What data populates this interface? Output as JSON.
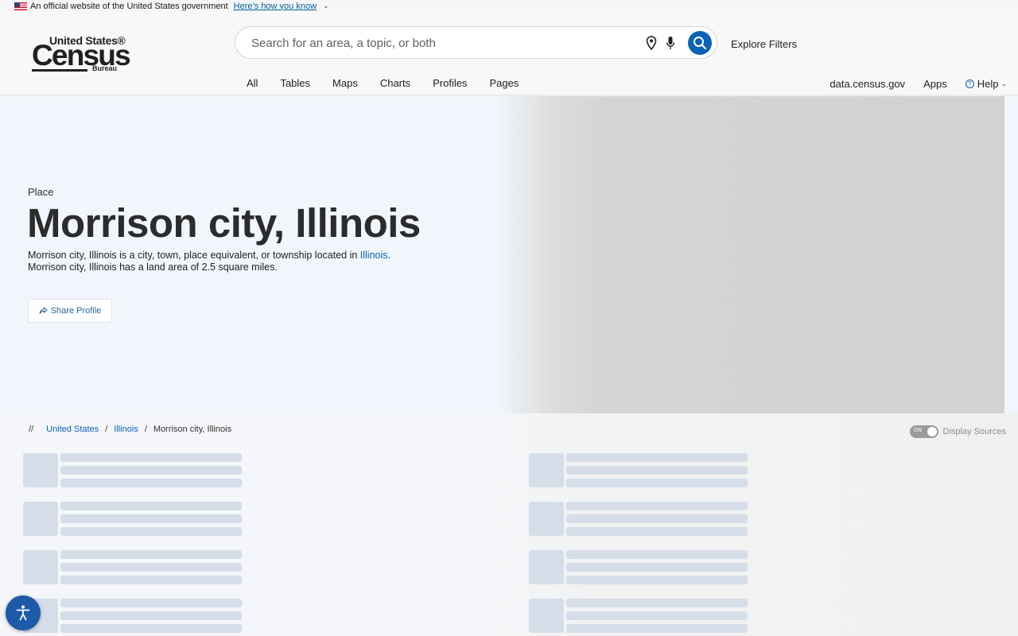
{
  "gov_banner": {
    "text": "An official website of the United States government",
    "link": "Here’s how you know"
  },
  "logo": {
    "top": "United States®",
    "main": "Census",
    "bureau": "Bureau"
  },
  "search": {
    "placeholder": "Search for an area, a topic, or both",
    "value": ""
  },
  "header": {
    "explore_filters": "Explore Filters",
    "tabs": [
      "All",
      "Tables",
      "Maps",
      "Charts",
      "Profiles",
      "Pages"
    ],
    "right_links": [
      "data.census.gov",
      "Apps"
    ],
    "help": "Help"
  },
  "hero": {
    "kind": "Place",
    "title": "Morrison city, Illinois",
    "desc_pre": "Morrison city, Illinois is a city, town, place equivalent, or township located in ",
    "desc_link": "Illinois",
    "desc_post": ".",
    "desc_line2": "Morrison city, Illinois has a land area of 2.5 square miles.",
    "share": "Share Profile"
  },
  "breadcrumb": {
    "prefix": "//",
    "items": [
      "United States",
      "Illinois"
    ],
    "current": "Morrison city, Illinois"
  },
  "sources_toggle": {
    "state": "ON",
    "label": "Display Sources"
  },
  "colors": {
    "accent": "#0a63b6",
    "hero_bg": "#f0f6fb",
    "skeleton": "#d5dde8"
  }
}
